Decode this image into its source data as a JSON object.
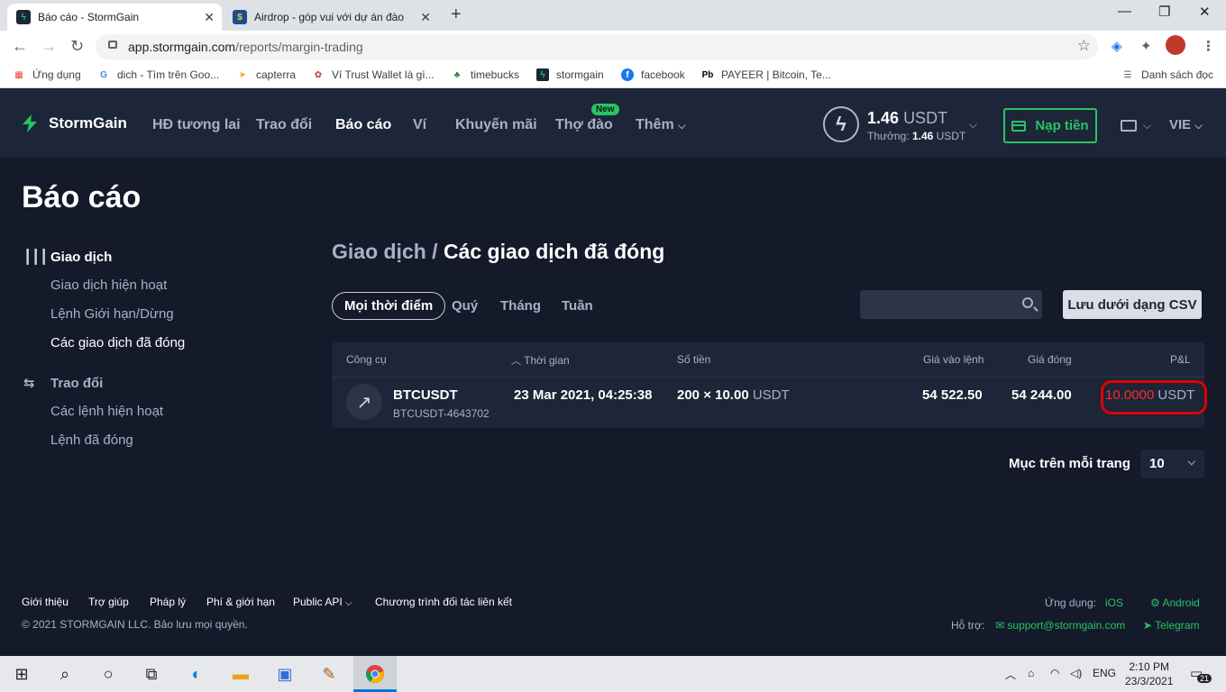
{
  "browser": {
    "tabs": [
      {
        "title": "Báo cáo - StormGain",
        "favicon": "stormgain-icon"
      },
      {
        "title": "Airdrop - góp vui với dự án đào",
        "favicon": "airdrop-icon"
      }
    ],
    "url_host": "app.stormgain.com",
    "url_path": "/reports/margin-trading",
    "bookmarks": [
      {
        "label": "Ứng dụng"
      },
      {
        "label": "dich - Tìm trên Goo..."
      },
      {
        "label": "capterra"
      },
      {
        "label": "Ví Trust Wallet là gì..."
      },
      {
        "label": "timebucks"
      },
      {
        "label": "stormgain"
      },
      {
        "label": "facebook"
      },
      {
        "label": "PAYEER | Bitcoin, Te..."
      }
    ],
    "reading_list": "Danh sách đọc"
  },
  "header": {
    "brand": "StormGain",
    "nav": [
      "HĐ tương lai",
      "Trao đổi",
      "Báo cáo",
      "Ví",
      "Khuyến mãi",
      "Thợ đào",
      "Thêm"
    ],
    "new_badge": "New",
    "balance_value": "1.46",
    "balance_unit": "USDT",
    "bonus_label": "Thưởng:",
    "bonus_value": "1.46",
    "bonus_unit": "USDT",
    "deposit": "Nạp tiền",
    "language": "VIE"
  },
  "page": {
    "title": "Báo cáo",
    "sidebar": {
      "group1": "Giao dịch",
      "group1_items": [
        "Giao dịch hiện hoạt",
        "Lệnh Giới hạn/Dừng",
        "Các giao dịch đã đóng"
      ],
      "group2": "Trao đổi",
      "group2_items": [
        "Các lệnh hiện hoạt",
        "Lệnh đã đóng"
      ]
    },
    "breadcrumb_parent": "Giao dịch /",
    "breadcrumb_current": "Các giao dịch đã đóng",
    "filters": [
      "Mọi thời điểm",
      "Quý",
      "Tháng",
      "Tuần"
    ],
    "csv_button": "Lưu dưới dạng CSV",
    "table": {
      "headers": [
        "Công cụ",
        "Thời gian",
        "Số tiền",
        "Giá vào lệnh",
        "Giá đóng",
        "P&L"
      ],
      "rows": [
        {
          "instrument": "BTCUSDT",
          "id": "BTCUSDT-4643702",
          "time": "23 Mar 2021, 04:25:38",
          "amount": "200 × 10.00",
          "amount_unit": "USDT",
          "entry": "54 522.50",
          "close": "54 244.00",
          "pnl": "10.0000",
          "pnl_unit": "USDT"
        }
      ]
    },
    "per_page_label": "Mục trên mỗi trang",
    "per_page_value": "10"
  },
  "footer": {
    "links": [
      "Giới thiệu",
      "Trợ giúp",
      "Pháp lý",
      "Phí & giới hạn",
      "Public API",
      "Chương trình đối tác liên kết"
    ],
    "copyright": "© 2021 STORMGAIN LLC. Bảo lưu mọi quyền.",
    "apps_label": "Ứng dụng:",
    "ios": "iOS",
    "android": "Android",
    "support_label": "Hỗ trợ:",
    "email": "support@stormgain.com",
    "telegram": "Telegram"
  },
  "taskbar": {
    "lang": "ENG",
    "time": "2:10 PM",
    "date": "23/3/2021",
    "notifications": "21"
  },
  "colors": {
    "accent_green": "#27c463",
    "header_bg": "#1d2538",
    "page_bg": "#141a2a",
    "annotation_red": "#e00000"
  }
}
